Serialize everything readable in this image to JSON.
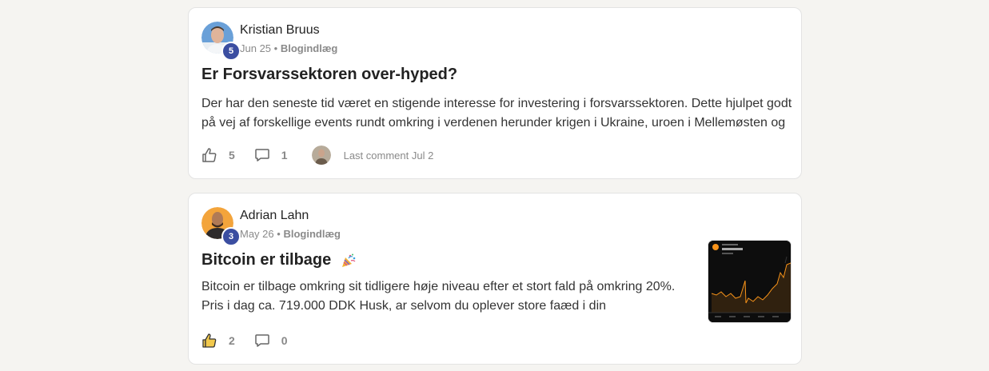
{
  "posts": [
    {
      "author": "Kristian Bruus",
      "level": "5",
      "date": "Jun 25",
      "separator": "•",
      "category": "Blogindlæg",
      "title": "Er Forsvarssektoren over-hyped?",
      "excerpt_line1": "Der har den seneste tid været en stigende interesse for investering i forsvarssektoren. Dette hjulpet godt",
      "excerpt_line2": "på vej af forskellige events rundt omkring i verdenen herunder krigen i Ukraine, uroen i Mellemøsten og",
      "likes": "5",
      "comments": "1",
      "last_comment": "Last comment Jul 2",
      "liked": false
    },
    {
      "author": "Adrian Lahn",
      "level": "3",
      "date": "May 26",
      "separator": "•",
      "category": "Blogindlæg",
      "title": "Bitcoin er tilbage",
      "title_emoji": "party-popper-icon",
      "excerpt_line1": "Bitcoin er tilbage omkring sit tidligere høje niveau efter et stort fald på omkring 20%.",
      "excerpt_line2": "Pris i dag ca. 719.000 DDK Husk, ar selvom du oplever store faæd i din",
      "likes": "2",
      "comments": "0",
      "liked": true
    }
  ],
  "colors": {
    "background": "#f5f4f1",
    "card": "#ffffff",
    "badge": "#3b4ea1",
    "liked_thumb": "#f2c94c"
  }
}
